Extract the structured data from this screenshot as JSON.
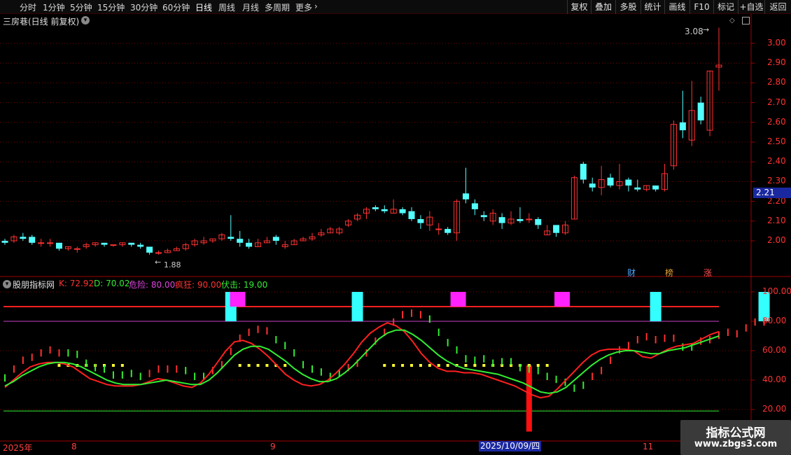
{
  "toolbar": {
    "periods": [
      "分时",
      "1分钟",
      "5分钟",
      "15分钟",
      "30分钟",
      "60分钟",
      "日线",
      "周线",
      "月线",
      "多周期",
      "更多"
    ],
    "active_period": "日线",
    "right_buttons": [
      "复权",
      "叠加",
      "多股",
      "统计",
      "画线",
      "F10",
      "标记",
      "+自选",
      "返回"
    ]
  },
  "main_chart": {
    "stock_label": "三房巷(日线 前复权)",
    "price_ticks": [
      "3.00",
      "2.90",
      "2.80",
      "2.70",
      "2.60",
      "2.50",
      "2.40",
      "2.30",
      "2.20",
      "2.10",
      "2.00"
    ],
    "current_price_badge": "2.21",
    "high_annotation": "3.08",
    "low_annotation": "1.88",
    "event_markers": [
      {
        "text": "财",
        "color": "#4aa8ff"
      },
      {
        "text": "榜",
        "color": "#e0a030"
      },
      {
        "text": "涨",
        "color": "#ff5050"
      }
    ],
    "colors": {
      "up": "#ff3232",
      "down": "#54ffff",
      "grid": "#7a0000",
      "axis": "#a00000"
    }
  },
  "indicator": {
    "name": "股朋指标网",
    "k_label": "K: 72.92",
    "d_label": "D: 70.02",
    "danger_label": "危险: 80.00",
    "crazy_label": "疯狂: 90.00",
    "ambush_label": "伏击: 19.00",
    "ticks": [
      "100.00",
      "80.00",
      "60.00",
      "40.00",
      "20.00"
    ],
    "colors": {
      "k": "#ff2020",
      "d": "#33ee33",
      "danger": "#cc44cc",
      "crazy": "#ff2020",
      "ambush": "#33ee33",
      "marker_cyan": "#33ffff",
      "marker_magenta": "#ff22ff",
      "dots": "#ffff33"
    }
  },
  "time_axis": {
    "labels": [
      "2025年",
      "8",
      "9",
      "2025/10/09/四",
      "11"
    ]
  },
  "chart_data": {
    "type": "candlestick",
    "ylim_price": [
      1.8,
      3.1
    ],
    "ylim_indicator": [
      10,
      105
    ],
    "candles": [
      [
        2.0,
        1.99,
        2.01,
        1.98
      ],
      [
        2.0,
        2.02,
        2.03,
        1.99
      ],
      [
        2.02,
        2.01,
        2.04,
        2.0
      ],
      [
        2.02,
        1.99,
        2.03,
        1.98
      ],
      [
        1.99,
        1.99,
        2.01,
        1.97
      ],
      [
        1.99,
        1.99,
        2.01,
        1.97
      ],
      [
        1.99,
        1.96,
        1.99,
        1.95
      ],
      [
        1.96,
        1.97,
        1.97,
        1.95
      ],
      [
        1.96,
        1.96,
        1.97,
        1.94
      ],
      [
        1.97,
        1.98,
        1.99,
        1.96
      ],
      [
        1.98,
        1.99,
        1.99,
        1.97
      ],
      [
        1.99,
        1.98,
        1.99,
        1.97
      ],
      [
        1.98,
        1.98,
        1.98,
        1.97
      ],
      [
        1.98,
        1.99,
        1.99,
        1.97
      ],
      [
        1.99,
        1.98,
        1.99,
        1.97
      ],
      [
        1.98,
        1.97,
        1.99,
        1.96
      ],
      [
        1.97,
        1.94,
        1.97,
        1.93
      ],
      [
        1.94,
        1.94,
        1.95,
        1.93
      ],
      [
        1.94,
        1.95,
        1.96,
        1.94
      ],
      [
        1.95,
        1.96,
        1.97,
        1.95
      ],
      [
        1.96,
        1.98,
        1.99,
        1.95
      ],
      [
        1.98,
        2.0,
        2.01,
        1.97
      ],
      [
        1.99,
        2.0,
        2.02,
        1.98
      ],
      [
        2.0,
        2.01,
        2.01,
        1.99
      ],
      [
        2.01,
        2.03,
        2.04,
        2.0
      ],
      [
        2.02,
        2.01,
        2.13,
        2.0
      ],
      [
        2.01,
        1.99,
        2.05,
        1.97
      ],
      [
        1.99,
        1.97,
        2.01,
        1.96
      ],
      [
        1.97,
        1.99,
        2.01,
        1.97
      ],
      [
        1.99,
        2.0,
        2.02,
        1.99
      ],
      [
        2.02,
        2.0,
        2.03,
        1.98
      ],
      [
        1.97,
        1.98,
        2.0,
        1.96
      ],
      [
        1.98,
        2.0,
        2.01,
        1.98
      ],
      [
        2.0,
        2.01,
        2.02,
        2.0
      ],
      [
        2.01,
        2.02,
        2.04,
        2.0
      ],
      [
        2.03,
        2.04,
        2.06,
        2.02
      ],
      [
        2.04,
        2.06,
        2.07,
        2.04
      ],
      [
        2.04,
        2.06,
        2.07,
        2.03
      ],
      [
        2.08,
        2.1,
        2.11,
        2.07
      ],
      [
        2.11,
        2.13,
        2.14,
        2.1
      ],
      [
        2.14,
        2.16,
        2.17,
        2.11
      ],
      [
        2.17,
        2.16,
        2.18,
        2.15
      ],
      [
        2.16,
        2.15,
        2.18,
        2.14
      ],
      [
        2.14,
        2.16,
        2.21,
        2.14
      ],
      [
        2.16,
        2.14,
        2.17,
        2.13
      ],
      [
        2.15,
        2.11,
        2.17,
        2.1
      ],
      [
        2.11,
        2.09,
        2.13,
        2.06
      ],
      [
        2.08,
        2.12,
        2.15,
        2.05
      ],
      [
        2.06,
        2.06,
        2.09,
        2.03
      ],
      [
        2.06,
        2.04,
        2.07,
        2.03
      ],
      [
        2.04,
        2.2,
        2.21,
        2.0
      ],
      [
        2.24,
        2.21,
        2.37,
        2.19
      ],
      [
        2.19,
        2.16,
        2.21,
        2.13
      ],
      [
        2.13,
        2.12,
        2.15,
        2.1
      ],
      [
        2.1,
        2.14,
        2.16,
        2.08
      ],
      [
        2.12,
        2.09,
        2.14,
        2.06
      ],
      [
        2.09,
        2.11,
        2.15,
        2.08
      ],
      [
        2.11,
        2.1,
        2.17,
        2.09
      ],
      [
        2.11,
        2.11,
        2.14,
        2.09
      ],
      [
        2.11,
        2.08,
        2.12,
        2.06
      ],
      [
        2.03,
        2.05,
        2.08,
        2.03
      ],
      [
        2.08,
        2.04,
        2.08,
        2.02
      ],
      [
        2.04,
        2.08,
        2.1,
        2.03
      ],
      [
        2.11,
        2.32,
        2.33,
        2.11
      ],
      [
        2.39,
        2.31,
        2.4,
        2.29
      ],
      [
        2.29,
        2.27,
        2.32,
        2.25
      ],
      [
        2.27,
        2.31,
        2.38,
        2.23
      ],
      [
        2.32,
        2.28,
        2.34,
        2.27
      ],
      [
        2.28,
        2.3,
        2.39,
        2.26
      ],
      [
        2.31,
        2.28,
        2.32,
        2.25
      ],
      [
        2.27,
        2.26,
        2.31,
        2.25
      ],
      [
        2.26,
        2.28,
        2.28,
        2.25
      ],
      [
        2.28,
        2.26,
        2.28,
        2.25
      ],
      [
        2.26,
        2.34,
        2.39,
        2.25
      ],
      [
        2.38,
        2.59,
        2.61,
        2.36
      ],
      [
        2.6,
        2.56,
        2.76,
        2.52
      ],
      [
        2.51,
        2.66,
        2.81,
        2.48
      ],
      [
        2.7,
        2.61,
        2.73,
        2.59
      ],
      [
        2.56,
        2.86,
        2.86,
        2.53
      ],
      [
        2.88,
        2.89,
        3.08,
        2.76
      ]
    ],
    "k_values": [
      35,
      40,
      45,
      49,
      51,
      52,
      52,
      51,
      49,
      45,
      41,
      39,
      37,
      36,
      36,
      36,
      37,
      39,
      41,
      40,
      38,
      36,
      35,
      38,
      44,
      52,
      60,
      66,
      67,
      65,
      61,
      56,
      50,
      44,
      40,
      37,
      36,
      37,
      40,
      45,
      51,
      58,
      66,
      72,
      76,
      79,
      77,
      73,
      66,
      58,
      52,
      48,
      46,
      46,
      45,
      45,
      44,
      42,
      40,
      38,
      36,
      33,
      30,
      28,
      29,
      34,
      40,
      46,
      52,
      57,
      60,
      61,
      61,
      61,
      60,
      56,
      55,
      58,
      61,
      63,
      64,
      65,
      68,
      71,
      73
    ],
    "d_values": [
      36,
      39,
      43,
      46,
      49,
      51,
      52,
      52,
      51,
      49,
      46,
      43,
      40,
      38,
      37,
      37,
      37,
      38,
      39,
      40,
      39,
      38,
      37,
      37,
      40,
      45,
      51,
      57,
      61,
      63,
      63,
      61,
      57,
      53,
      48,
      44,
      41,
      39,
      39,
      41,
      45,
      50,
      56,
      62,
      68,
      72,
      74,
      74,
      71,
      67,
      62,
      57,
      53,
      50,
      48,
      47,
      46,
      45,
      44,
      42,
      40,
      38,
      35,
      32,
      31,
      32,
      35,
      40,
      45,
      50,
      54,
      57,
      59,
      60,
      60,
      59,
      58,
      58,
      60,
      61,
      62,
      64,
      66,
      68,
      70
    ]
  }
}
